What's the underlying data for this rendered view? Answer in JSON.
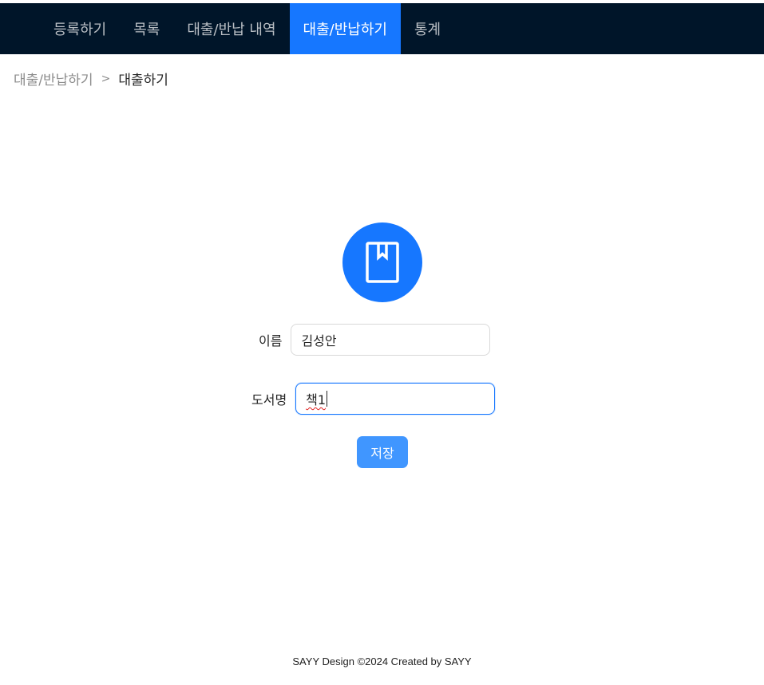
{
  "nav": {
    "items": [
      {
        "label": "등록하기"
      },
      {
        "label": "목록"
      },
      {
        "label": "대출/반납 내역"
      },
      {
        "label": "대출/반납하기",
        "active": true
      },
      {
        "label": "통계"
      }
    ]
  },
  "breadcrumb": {
    "parent": "대출/반납하기",
    "separator": ">",
    "current": "대출하기"
  },
  "form": {
    "icon": "book-icon",
    "name": {
      "label": "이름",
      "value": "김성안"
    },
    "book_title": {
      "label": "도서명",
      "value": "책1"
    },
    "save_label": "저장"
  },
  "footer": {
    "text": "SAYY Design ©2024 Created by SAYY"
  },
  "colors": {
    "header_bg": "#001529",
    "accent": "#1677ff",
    "button": "#4096ff"
  }
}
